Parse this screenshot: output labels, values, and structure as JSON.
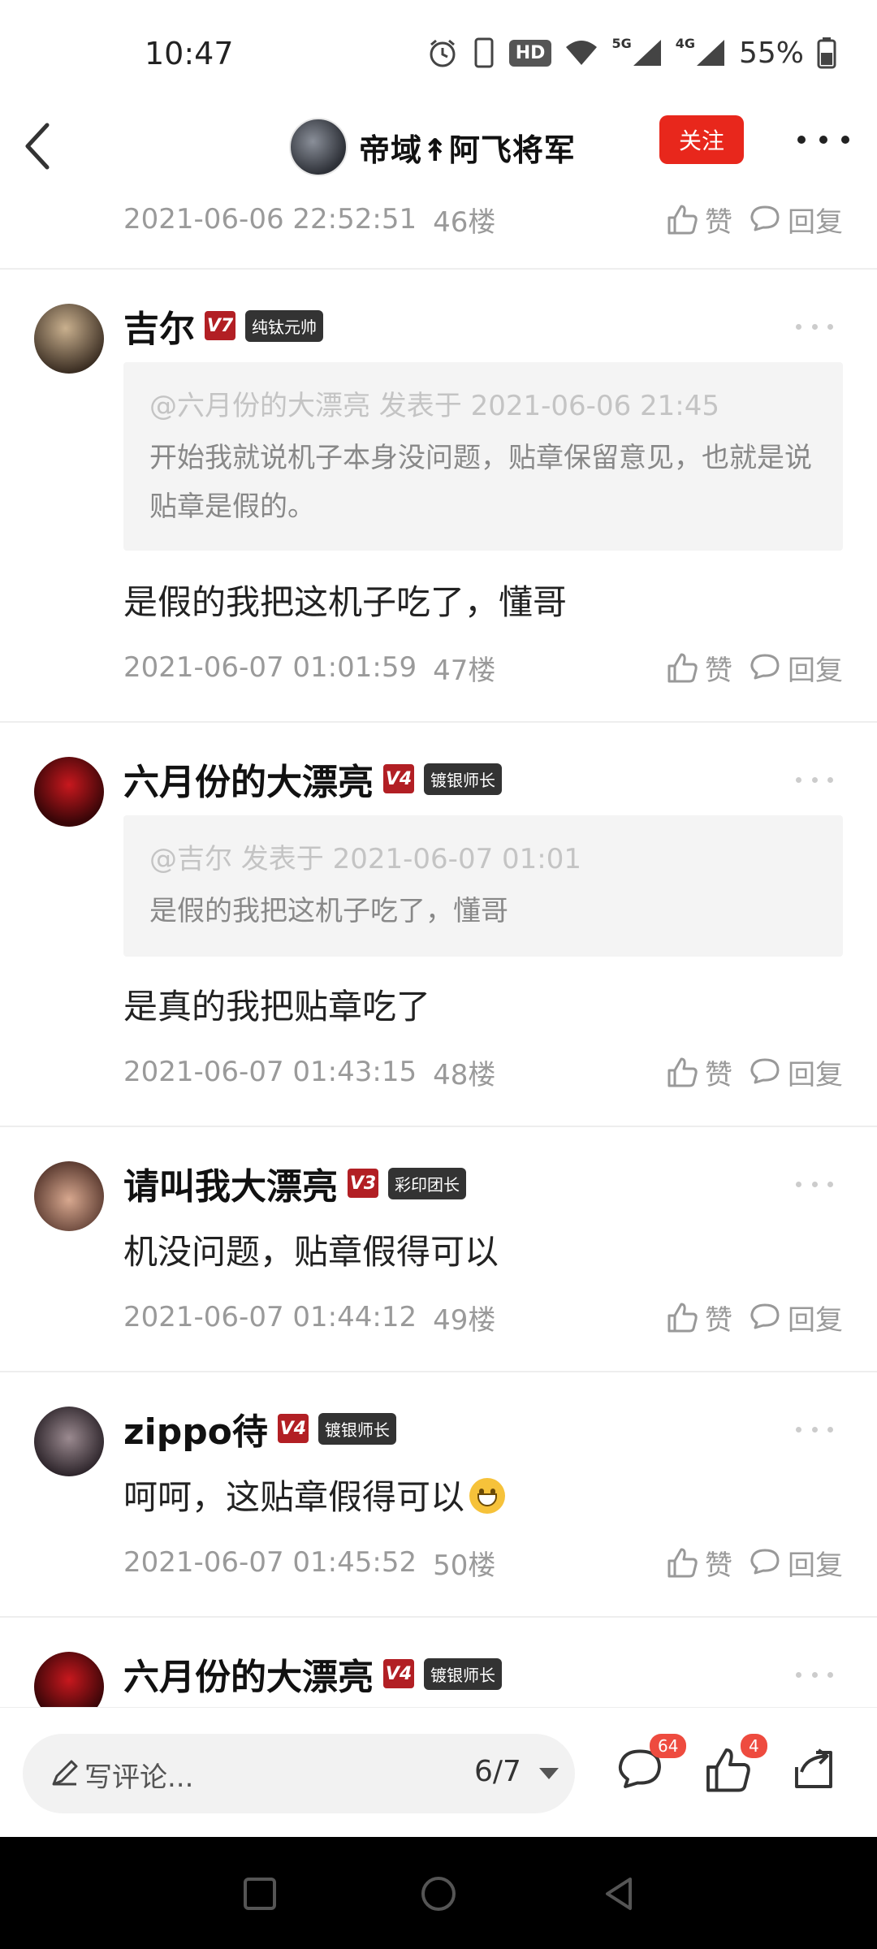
{
  "status_bar": {
    "time": "10:47",
    "hd": "HD",
    "net1": "5G",
    "net2": "4G",
    "battery": "55%",
    "icons": [
      "alarm-icon",
      "phone-icon",
      "hd-icon",
      "wifi-icon",
      "signal-icon",
      "battery-icon"
    ]
  },
  "header": {
    "back_icon": "back-chevron-icon",
    "title": "帝域↟阿飞将军",
    "follow_label": "关注",
    "more_icon": "more-dots-icon"
  },
  "posts": [
    {
      "timestamp": "2021-06-06 22:52:51",
      "floor": "46楼",
      "like_label": "赞",
      "reply_label": "回复"
    },
    {
      "username": "吉尔",
      "level": "V7",
      "title_badge": "纯钛元帅",
      "quote_head": "@六月份的大漂亮 发表于 2021-06-06 21:45",
      "quote_body": "开始我就说机子本身没问题，贴章保留意见，也就是说贴章是假的。",
      "content": "是假的我把这机子吃了，懂哥",
      "timestamp": "2021-06-07 01:01:59",
      "floor": "47楼",
      "like_label": "赞",
      "reply_label": "回复"
    },
    {
      "username": "六月份的大漂亮",
      "level": "V4",
      "title_badge": "镀银师长",
      "quote_head": "@吉尔 发表于 2021-06-07 01:01",
      "quote_body": "是假的我把这机子吃了，懂哥",
      "content": "是真的我把贴章吃了",
      "timestamp": "2021-06-07 01:43:15",
      "floor": "48楼",
      "like_label": "赞",
      "reply_label": "回复"
    },
    {
      "username": "请叫我大漂亮",
      "level": "V3",
      "title_badge": "彩印团长",
      "content": "机没问题，贴章假得可以",
      "timestamp": "2021-06-07 01:44:12",
      "floor": "49楼",
      "like_label": "赞",
      "reply_label": "回复"
    },
    {
      "username": "zippo待",
      "level": "V4",
      "title_badge": "镀银师长",
      "content": "呵呵，这贴章假得可以",
      "emoji": "grin-emoji",
      "timestamp": "2021-06-07 01:45:52",
      "floor": "50楼",
      "like_label": "赞",
      "reply_label": "回复"
    },
    {
      "username": "六月份的大漂亮",
      "level": "V4",
      "title_badge": "镀银师长"
    }
  ],
  "bottom_bar": {
    "comment_placeholder": "写评论...",
    "page_indicator": "6/7",
    "comment_count": "64",
    "like_count": "4"
  },
  "nav_bar": {
    "icons": [
      "recents-square-icon",
      "home-circle-icon",
      "back-triangle-icon"
    ]
  },
  "colors": {
    "accent_red": "#e8271c",
    "level_badge": "#b21f24",
    "muted_text": "#9a9a9a"
  }
}
